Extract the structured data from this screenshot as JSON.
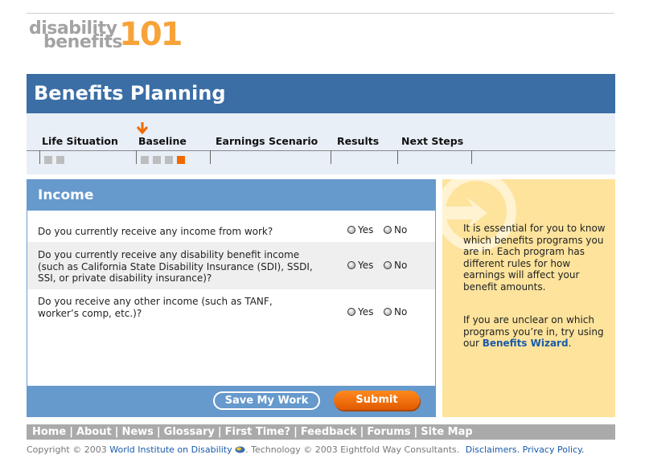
{
  "logo": {
    "line1": "disability",
    "line2": "benefits",
    "number": "101"
  },
  "banner": {
    "title": "Benefits Planning"
  },
  "steps": [
    {
      "label": "Life Situation"
    },
    {
      "label": "Baseline"
    },
    {
      "label": "Earnings Scenario"
    },
    {
      "label": "Results"
    },
    {
      "label": "Next Steps"
    }
  ],
  "panel": {
    "title": "Income",
    "questions": [
      {
        "text": "Do you currently receive any income from work?",
        "yes": "Yes",
        "no": "No"
      },
      {
        "text": "Do you currently receive any disability benefit income (such as California State Disability Insurance (SDI), SSDI, SSI, or private disability insurance)?",
        "yes": "Yes",
        "no": "No"
      },
      {
        "text": "Do you receive any other income (such as TANF, worker’s comp, etc.)?",
        "yes": "Yes",
        "no": "No"
      }
    ],
    "save_label": "Save My Work",
    "submit_label": "Submit"
  },
  "sidebar": {
    "para1": "It is essential for you to know which  benefits programs you are in. Each program has different rules for how earnings will affect your benefit amounts.",
    "para2_before": "If you are unclear on which programs you’re in, try using our ",
    "para2_link": "Benefits Wizard",
    "para2_after": "."
  },
  "nav": [
    "Home",
    "About",
    "News",
    "Glossary",
    "First Time?",
    "Feedback",
    "Forums",
    "Site Map"
  ],
  "footer": {
    "copyright": "Copyright © 2003 ",
    "org": "World Institute on Disability",
    "tech": ". Technology © 2003 Eightfold Way Consultants.",
    "disclaimers": "Disclaimers.",
    "privacy": "Privacy Policy."
  },
  "colors": {
    "banner": "#3a6ea5",
    "panel": "#6699cc",
    "accent": "#f06a00",
    "sidebar": "#fde39c"
  }
}
